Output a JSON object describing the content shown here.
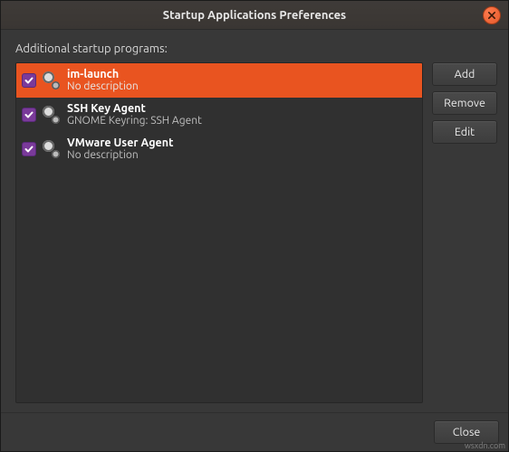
{
  "window": {
    "title": "Startup Applications Preferences"
  },
  "section_label": "Additional startup programs:",
  "items": [
    {
      "name": "im-launch",
      "desc": "No description",
      "checked": true,
      "selected": true
    },
    {
      "name": "SSH Key Agent",
      "desc": "GNOME Keyring: SSH Agent",
      "checked": true,
      "selected": false
    },
    {
      "name": "VMware User Agent",
      "desc": "No description",
      "checked": true,
      "selected": false
    }
  ],
  "buttons": {
    "add": "Add",
    "remove": "Remove",
    "edit": "Edit",
    "close": "Close"
  },
  "watermark": "wsxdn.com"
}
